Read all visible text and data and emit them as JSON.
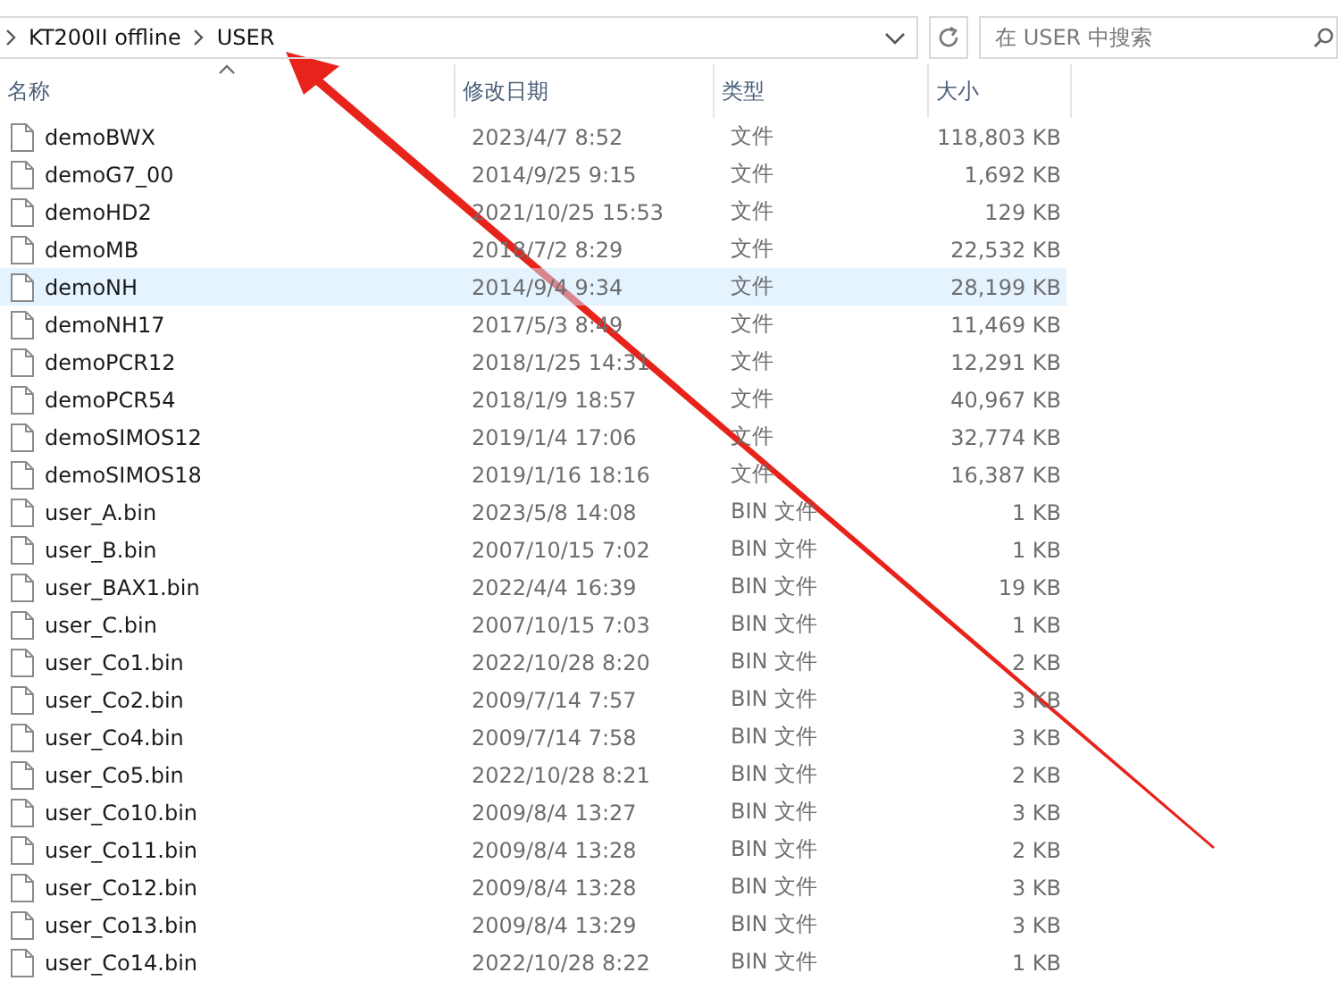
{
  "address_bar": {
    "path": [
      "KT200II offline",
      "USER"
    ]
  },
  "search": {
    "placeholder": "在 USER 中搜索"
  },
  "table": {
    "columns": [
      {
        "label": "名称",
        "sorted": true
      },
      {
        "label": "修改日期",
        "sorted": false
      },
      {
        "label": "类型",
        "sorted": false
      },
      {
        "label": "大小",
        "sorted": false
      }
    ],
    "rows": [
      {
        "name": "demoBWX",
        "modified": "2023/4/7 8:52",
        "type": "文件",
        "size": "118,803 KB",
        "selected": false
      },
      {
        "name": "demoG7_00",
        "modified": "2014/9/25 9:15",
        "type": "文件",
        "size": "1,692 KB",
        "selected": false
      },
      {
        "name": "demoHD2",
        "modified": "2021/10/25 15:53",
        "type": "文件",
        "size": "129 KB",
        "selected": false
      },
      {
        "name": "demoMB",
        "modified": "2018/7/2 8:29",
        "type": "文件",
        "size": "22,532 KB",
        "selected": false
      },
      {
        "name": "demoNH",
        "modified": "2014/9/4 9:34",
        "type": "文件",
        "size": "28,199 KB",
        "selected": true
      },
      {
        "name": "demoNH17",
        "modified": "2017/5/3 8:49",
        "type": "文件",
        "size": "11,469 KB",
        "selected": false
      },
      {
        "name": "demoPCR12",
        "modified": "2018/1/25 14:31",
        "type": "文件",
        "size": "12,291 KB",
        "selected": false
      },
      {
        "name": "demoPCR54",
        "modified": "2018/1/9 18:57",
        "type": "文件",
        "size": "40,967 KB",
        "selected": false
      },
      {
        "name": "demoSIMOS12",
        "modified": "2019/1/4 17:06",
        "type": "文件",
        "size": "32,774 KB",
        "selected": false
      },
      {
        "name": "demoSIMOS18",
        "modified": "2019/1/16 18:16",
        "type": "文件",
        "size": "16,387 KB",
        "selected": false
      },
      {
        "name": "user_A.bin",
        "modified": "2023/5/8 14:08",
        "type": "BIN 文件",
        "size": "1 KB",
        "selected": false
      },
      {
        "name": "user_B.bin",
        "modified": "2007/10/15 7:02",
        "type": "BIN 文件",
        "size": "1 KB",
        "selected": false
      },
      {
        "name": "user_BAX1.bin",
        "modified": "2022/4/4 16:39",
        "type": "BIN 文件",
        "size": "19 KB",
        "selected": false
      },
      {
        "name": "user_C.bin",
        "modified": "2007/10/15 7:03",
        "type": "BIN 文件",
        "size": "1 KB",
        "selected": false
      },
      {
        "name": "user_Co1.bin",
        "modified": "2022/10/28 8:20",
        "type": "BIN 文件",
        "size": "2 KB",
        "selected": false
      },
      {
        "name": "user_Co2.bin",
        "modified": "2009/7/14 7:57",
        "type": "BIN 文件",
        "size": "3 KB",
        "selected": false
      },
      {
        "name": "user_Co4.bin",
        "modified": "2009/7/14 7:58",
        "type": "BIN 文件",
        "size": "3 KB",
        "selected": false
      },
      {
        "name": "user_Co5.bin",
        "modified": "2022/10/28 8:21",
        "type": "BIN 文件",
        "size": "2 KB",
        "selected": false
      },
      {
        "name": "user_Co10.bin",
        "modified": "2009/8/4 13:27",
        "type": "BIN 文件",
        "size": "3 KB",
        "selected": false
      },
      {
        "name": "user_Co11.bin",
        "modified": "2009/8/4 13:28",
        "type": "BIN 文件",
        "size": "2 KB",
        "selected": false
      },
      {
        "name": "user_Co12.bin",
        "modified": "2009/8/4 13:28",
        "type": "BIN 文件",
        "size": "3 KB",
        "selected": false
      },
      {
        "name": "user_Co13.bin",
        "modified": "2009/8/4 13:29",
        "type": "BIN 文件",
        "size": "3 KB",
        "selected": false
      },
      {
        "name": "user_Co14.bin",
        "modified": "2022/10/28 8:22",
        "type": "BIN 文件",
        "size": "1 KB",
        "selected": false
      }
    ]
  }
}
